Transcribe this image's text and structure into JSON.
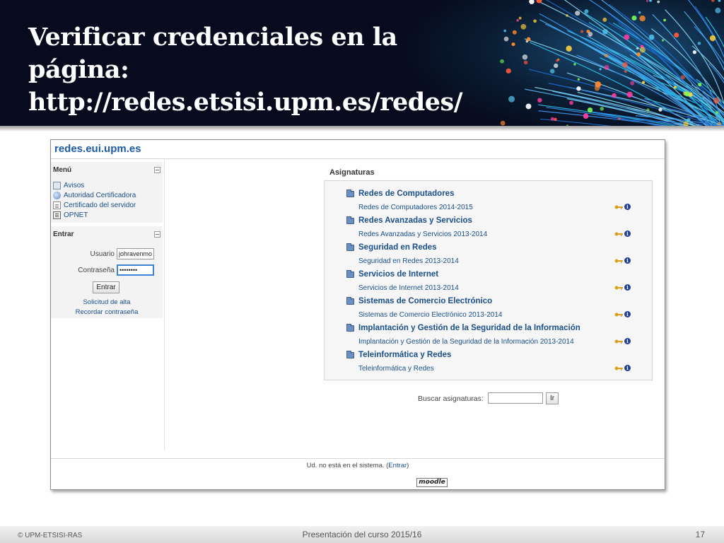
{
  "slide": {
    "title_lines": [
      "Verificar credenciales en la",
      "página:",
      "http://redes.etsisi.upm.es/redes/"
    ]
  },
  "site": {
    "title": "redes.eui.upm.es"
  },
  "sidebar": {
    "menu": {
      "title": "Menú",
      "items": [
        {
          "label": "Avisos",
          "icon": "forum-icon"
        },
        {
          "label": "Autoridad Certificadora",
          "icon": "globe-icon"
        },
        {
          "label": "Certificado del servidor",
          "icon": "document-icon"
        },
        {
          "label": "OPNET",
          "icon": "file-icon"
        }
      ]
    },
    "login": {
      "title": "Entrar",
      "username_label": "Usuario",
      "username_value": "johravenmo",
      "password_label": "Contraseña",
      "password_value": "••••••••",
      "submit_label": "Entrar",
      "signup_link": "Solicitud de alta",
      "forgot_link": "Recordar contraseña"
    }
  },
  "main": {
    "heading": "Asignaturas",
    "courses": [
      {
        "name": "Redes de Computadores",
        "sub": "Redes de Computadores 2014-2015"
      },
      {
        "name": "Redes Avanzadas y Servicios",
        "sub": "Redes Avanzadas y Servicios 2013-2014"
      },
      {
        "name": "Seguridad en Redes",
        "sub": "Seguridad en Redes 2013-2014"
      },
      {
        "name": "Servicios de Internet",
        "sub": "Servicios de Internet 2013-2014"
      },
      {
        "name": "Sistemas de Comercio Electrónico",
        "sub": "Sistemas de Comercio Electrónico 2013-2014"
      },
      {
        "name": "Implantación y Gestión de la Seguridad de la Información",
        "sub": "Implantación y Gestión de la Seguridad de la Información 2013-2014"
      },
      {
        "name": "Teleinformática y Redes",
        "sub": "Teleinformática y Redes"
      }
    ],
    "search_label": "Buscar asignaturas:",
    "search_value": "",
    "search_button": "Ir"
  },
  "site_footer": {
    "login_info_prefix": "Ud. no está en el sistema. (",
    "login_info_link": "Entrar",
    "login_info_suffix": ")",
    "logo_text": "moodle"
  },
  "slide_footer": {
    "copyright": "© UPM-ETSISI-RAS",
    "center": "Presentación del curso 2015/16",
    "page": "17"
  },
  "colors": {
    "header_bg": "#070b1d",
    "link": "#1a4f8a",
    "site_title": "#1a5aa8"
  }
}
